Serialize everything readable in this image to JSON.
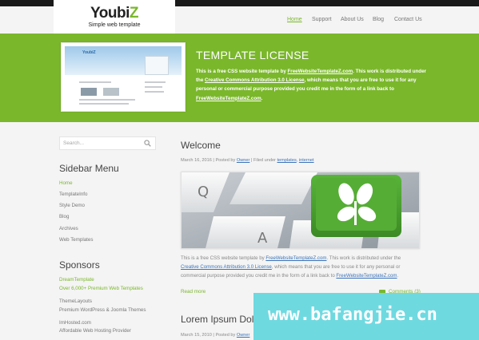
{
  "brand": {
    "name_main": "Youbi",
    "name_accent": "Z",
    "tagline": "Simple web template",
    "accent_color": "#7ab72b"
  },
  "nav": {
    "items": [
      {
        "label": "Home",
        "active": true
      },
      {
        "label": "Support",
        "active": false
      },
      {
        "label": "About Us",
        "active": false
      },
      {
        "label": "Blog",
        "active": false
      },
      {
        "label": "Contact Us",
        "active": false
      }
    ]
  },
  "hero": {
    "screenshot_logo": "YoubiZ",
    "title": "TEMPLATE LICENSE",
    "text_1": "This is a free CSS website template by ",
    "link_1": "FreeWebsiteTemplateZ.com",
    "text_2": ". This work is distributed under the ",
    "link_2": "Creative Commons Attribution 3.0 License",
    "text_3": ", which means that you are free to use it for any personal or commercial purpose provided you credit me in the form of a link back to ",
    "link_3": "FreeWebsiteTemplateZ.com",
    "text_4": "."
  },
  "sidebar": {
    "search_placeholder": "Search...",
    "menu_title": "Sidebar Menu",
    "menu": [
      {
        "label": "Home",
        "active": true
      },
      {
        "label": "TemplateInfo",
        "active": false
      },
      {
        "label": "Style Demo",
        "active": false
      },
      {
        "label": "Blog",
        "active": false
      },
      {
        "label": "Archives",
        "active": false
      },
      {
        "label": "Web Templates",
        "active": false
      }
    ],
    "sponsors_title": "Sponsors",
    "sponsors": [
      {
        "name": "DreamTemplate",
        "desc": "Over 6,000+ Premium Web Templates",
        "green": true
      },
      {
        "name": "ThemeLayouts",
        "desc": "Premium WordPress & Joomla Themes",
        "green": false
      },
      {
        "name": "ImHosted.com",
        "desc": "Affordable Web Hosting Provider",
        "green": false
      }
    ]
  },
  "posts": [
    {
      "title": "Welcome",
      "date": "March 16, 2016",
      "posted_by": "Posted by",
      "author": "Owner",
      "filed": "Filed under",
      "tags": [
        "templates",
        "internet"
      ],
      "body_1": "This is a free CSS website template by ",
      "body_link_1": "FreeWebsiteTemplateZ.com",
      "body_2": ". This work is distributed under the ",
      "body_link_2": "Creative Commons Attribution 3.0 License",
      "body_3": ", which means that you are free to use it for any personal or commercial purpose provided you credit me in the form of a link back to ",
      "body_link_3": "FreeWebsiteTemplateZ.com",
      "body_4": ".",
      "read_more": "Read more",
      "comments": "Comments (3)"
    },
    {
      "title": "Lorem Ipsum Dolo",
      "date": "March 15, 2010",
      "posted_by": "Posted by",
      "author": "Owner"
    }
  ],
  "watermark": "www.bafangjie.cn"
}
